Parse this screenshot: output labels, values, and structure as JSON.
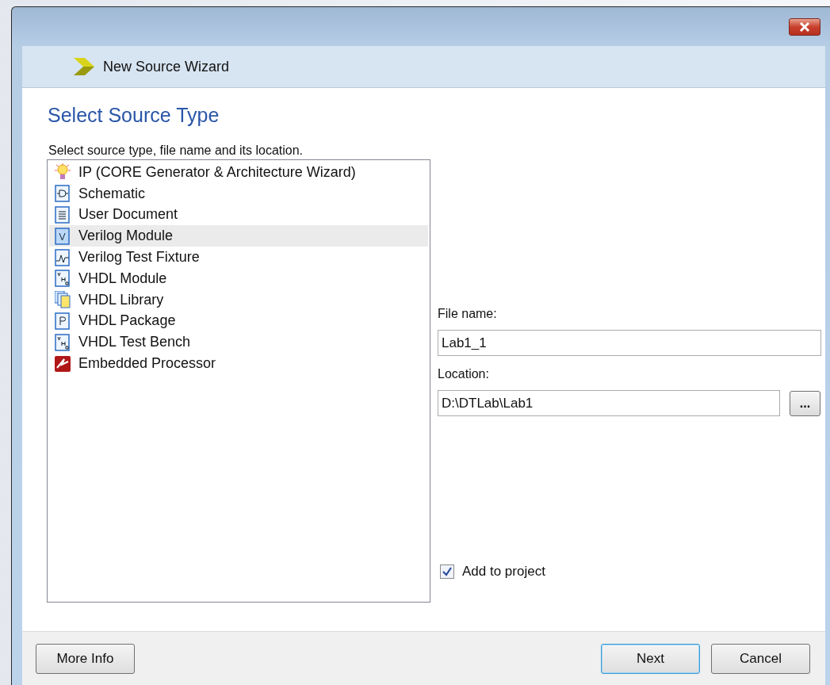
{
  "window": {
    "title": "New Source Wizard"
  },
  "page": {
    "heading": "Select Source Type",
    "instruction": "Select source type, file name and its location."
  },
  "source_types": [
    {
      "label": "IP (CORE Generator & Architecture Wizard)",
      "kind": "bulb",
      "selected": false
    },
    {
      "label": "Schematic",
      "kind": "schematic",
      "selected": false
    },
    {
      "label": "User Document",
      "kind": "document",
      "selected": false
    },
    {
      "label": "Verilog Module",
      "kind": "verilog",
      "selected": true
    },
    {
      "label": "Verilog Test Fixture",
      "kind": "fixture",
      "selected": false
    },
    {
      "label": "VHDL Module",
      "kind": "vhdl",
      "selected": false
    },
    {
      "label": "VHDL Library",
      "kind": "library",
      "selected": false
    },
    {
      "label": "VHDL Package",
      "kind": "package",
      "selected": false
    },
    {
      "label": "VHDL Test Bench",
      "kind": "testbench",
      "selected": false
    },
    {
      "label": "Embedded Processor",
      "kind": "processor",
      "selected": false
    }
  ],
  "file_name": {
    "label": "File name:",
    "value": "Lab1_1"
  },
  "location": {
    "label": "Location:",
    "value": "D:\\DTLab\\Lab1",
    "browse": "..."
  },
  "add_to_project": {
    "label": "Add to project",
    "checked": true
  },
  "buttons": {
    "more_info": "More Info",
    "next": "Next",
    "cancel": "Cancel"
  }
}
